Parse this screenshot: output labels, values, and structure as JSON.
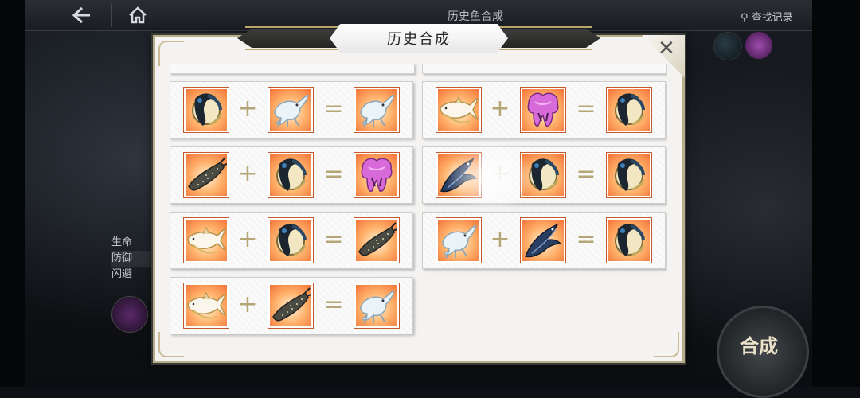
{
  "topbar": {
    "back_icon": "back-arrow-icon",
    "home_icon": "home-icon",
    "title": "历史鱼合成",
    "search_label": "查找记录"
  },
  "side_stats": [
    "生命",
    "防御",
    "闪避"
  ],
  "merge_button_label": "合成",
  "dialog": {
    "title": "历史合成",
    "close_icon": "close-icon"
  },
  "fish_types": {
    "dark": "dark-eel-fish",
    "pale": "pale-lizard-fish",
    "pink": "pink-jelly-fish",
    "white": "white-shark-fish",
    "whale": "whale-shark-fish",
    "swift": "blue-swift-fish"
  },
  "records": [
    {
      "a": "dark",
      "b": "pale",
      "result": "pale"
    },
    {
      "a": "white",
      "b": "pink",
      "result": "dark"
    },
    {
      "a": "whale",
      "b": "dark",
      "result": "pink"
    },
    {
      "a": "swift",
      "b": "dark",
      "result": "dark"
    },
    {
      "a": "white",
      "b": "dark",
      "result": "whale"
    },
    {
      "a": "pale",
      "b": "swift",
      "result": "dark"
    },
    {
      "a": "white",
      "b": "whale",
      "result": "pale"
    }
  ],
  "operators": {
    "plus": "+",
    "equals": "="
  }
}
